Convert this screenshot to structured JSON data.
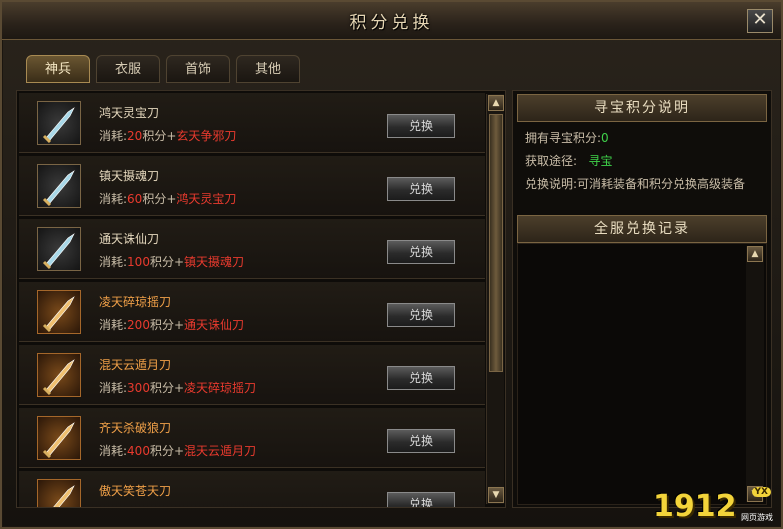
{
  "window": {
    "title": "积分兑换",
    "close_label": "✕"
  },
  "tabs": [
    {
      "label": "神兵",
      "active": true
    },
    {
      "label": "衣服",
      "active": false
    },
    {
      "label": "首饰",
      "active": false
    },
    {
      "label": "其他",
      "active": false
    }
  ],
  "items": [
    {
      "name": "鸿天灵宝刀",
      "cost_prefix": "消耗:",
      "cost_points": "20",
      "cost_mid": "积分+",
      "cost_item": "玄天争邪刀",
      "button": "兑换",
      "icon": "blade-icon",
      "rarity": "silver",
      "name_color": "#e5d8bd"
    },
    {
      "name": "镇天摄魂刀",
      "cost_prefix": "消耗:",
      "cost_points": "60",
      "cost_mid": "积分+",
      "cost_item": "鸿天灵宝刀",
      "button": "兑换",
      "icon": "blade-icon",
      "rarity": "silver",
      "name_color": "#e5d8bd"
    },
    {
      "name": "通天诛仙刀",
      "cost_prefix": "消耗:",
      "cost_points": "100",
      "cost_mid": "积分+",
      "cost_item": "镇天摄魂刀",
      "button": "兑换",
      "icon": "blade-icon",
      "rarity": "silver",
      "name_color": "#e5d8bd"
    },
    {
      "name": "凌天碎琼摇刀",
      "cost_prefix": "消耗:",
      "cost_points": "200",
      "cost_mid": "积分+",
      "cost_item": "通天诛仙刀",
      "button": "兑换",
      "icon": "blade-icon",
      "rarity": "gold",
      "name_color": "#f0a048"
    },
    {
      "name": "混天云遁月刀",
      "cost_prefix": "消耗:",
      "cost_points": "300",
      "cost_mid": "积分+",
      "cost_item": "凌天碎琼摇刀",
      "button": "兑换",
      "icon": "blade-icon",
      "rarity": "gold",
      "name_color": "#f0a048"
    },
    {
      "name": "齐天杀破狼刀",
      "cost_prefix": "消耗:",
      "cost_points": "400",
      "cost_mid": "积分+",
      "cost_item": "混天云遁月刀",
      "button": "兑换",
      "icon": "blade-icon",
      "rarity": "gold",
      "name_color": "#f0a048"
    },
    {
      "name": "傲天笑苍天刀",
      "cost_prefix": "",
      "cost_points": "",
      "cost_mid": "",
      "cost_item": "",
      "button": "兑换",
      "icon": "blade-icon",
      "rarity": "gold",
      "name_color": "#f0a048"
    }
  ],
  "info": {
    "header": "寻宝积分说明",
    "points_label": "拥有寻宝积分:",
    "points_value": "0",
    "source_label": "获取途径:",
    "source_value": "寻宝",
    "desc": "兑换说明:可消耗装备和积分兑换高级装备"
  },
  "log": {
    "header": "全服兑换记录"
  },
  "watermark": {
    "number": "1912",
    "badge": "YX",
    "sub": "网页游戏"
  },
  "colors": {
    "accent_gold": "#a88a52",
    "cost_red": "#e93a2e",
    "link_green": "#3fd24a",
    "rare_orange": "#f0a048"
  }
}
